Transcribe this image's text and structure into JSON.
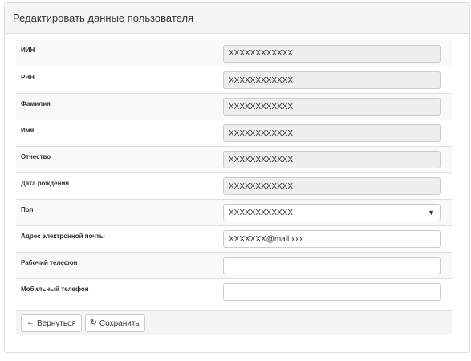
{
  "panel": {
    "title": "Редактировать данные пользователя"
  },
  "form": {
    "rows": [
      {
        "label": "ИИН",
        "value": "XXXXXXXXXXXX",
        "readonly": true
      },
      {
        "label": "РНН",
        "value": "XXXXXXXXXXXX",
        "readonly": true
      },
      {
        "label": "Фамилия",
        "value": "XXXXXXXXXXXX",
        "readonly": true
      },
      {
        "label": "Имя",
        "value": "XXXXXXXXXXXX",
        "readonly": true
      },
      {
        "label": "Отчество",
        "value": "XXXXXXXXXXXX",
        "readonly": true
      },
      {
        "label": "Дата рождения",
        "value": "XXXXXXXXXXXX",
        "readonly": true
      },
      {
        "label": "Пол",
        "value": "XXXXXXXXXXXX",
        "type": "select"
      },
      {
        "label": "Адрес электронной почты",
        "value": "XXXXXXX@mail.xxx"
      },
      {
        "label": "Рабочий телефон",
        "value": ""
      },
      {
        "label": "Мобильный телефон",
        "value": ""
      }
    ]
  },
  "buttons": {
    "back_icon": "←",
    "back_label": "Вернуться",
    "save_icon": "↻",
    "save_label": "Сохранить"
  },
  "icons": {
    "caret": "▼"
  },
  "colors": {
    "heading_bg": "#f5f5f5",
    "readonly_bg": "#eeeeee",
    "border": "#dddddd"
  }
}
